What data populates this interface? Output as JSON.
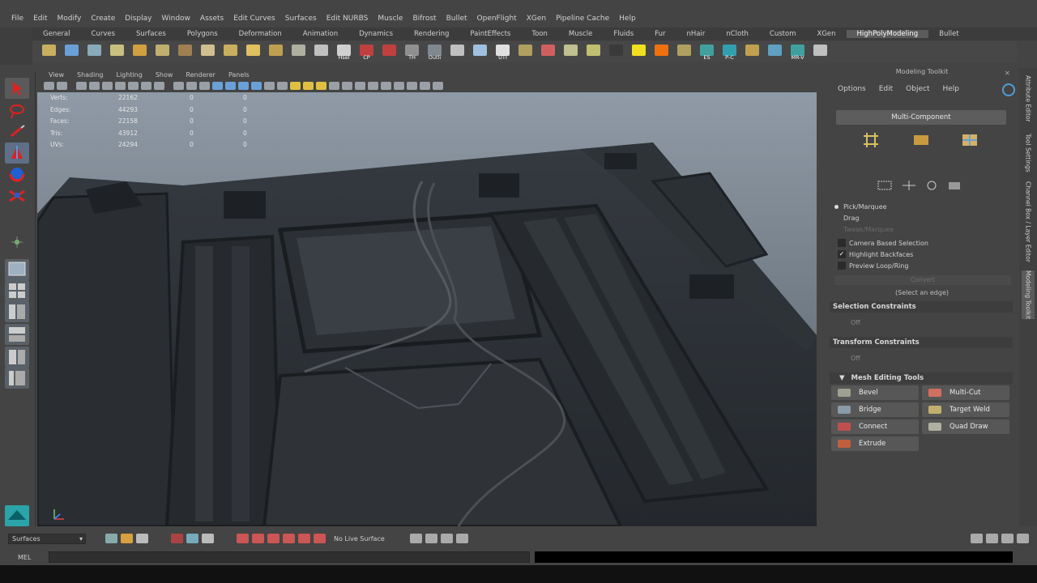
{
  "menubar": [
    "File",
    "Edit",
    "Modify",
    "Create",
    "Display",
    "Window",
    "Assets",
    "Edit Curves",
    "Surfaces",
    "Edit NURBS",
    "Muscle",
    "Bifrost",
    "Bullet",
    "OpenFlight",
    "XGen",
    "Pipeline Cache",
    "Help"
  ],
  "shelf_tabs": [
    "General",
    "Curves",
    "Surfaces",
    "Polygons",
    "Deformation",
    "Animation",
    "Dynamics",
    "Rendering",
    "PaintEffects",
    "Toon",
    "Muscle",
    "Fluids",
    "Fur",
    "nHair",
    "nCloth",
    "Custom",
    "XGen",
    "HighPolyModeling",
    "Bullet"
  ],
  "shelf_tab_active": "HighPolyModeling",
  "shelf_icon_labels": [
    "",
    "",
    "",
    "",
    "",
    "",
    "",
    "",
    "",
    "",
    "",
    "",
    "",
    "Hsel",
    "CP",
    "",
    "TH",
    "Outli",
    "",
    "",
    "UTI",
    "",
    "",
    "",
    "",
    "",
    "",
    "",
    "",
    "ES",
    "P-C",
    "",
    "",
    "MR-V",
    ""
  ],
  "viewport": {
    "menu": [
      "View",
      "Shading",
      "Lighting",
      "Show",
      "Renderer",
      "Panels"
    ],
    "hud": [
      [
        "Verts:",
        "22162",
        "0",
        "0"
      ],
      [
        "Edges:",
        "44293",
        "0",
        "0"
      ],
      [
        "Faces:",
        "22158",
        "0",
        "0"
      ],
      [
        "Tris:",
        "43912",
        "0",
        "0"
      ],
      [
        "UVs:",
        "24294",
        "0",
        "0"
      ]
    ]
  },
  "panel": {
    "title": "Modeling Toolkit",
    "menu": [
      "Options",
      "Edit",
      "Object",
      "Help"
    ],
    "multi_component": "Multi-Component",
    "selection_modes": [
      "Pick/Marquee",
      "Drag",
      "Tweak/Marquee"
    ],
    "checkboxes": [
      {
        "label": "Camera Based Selection",
        "checked": false
      },
      {
        "label": "Highlight Backfaces",
        "checked": true
      },
      {
        "label": "Preview Loop/Ring",
        "checked": false
      }
    ],
    "convert_button": "Convert",
    "hint": "(Select an edge)",
    "sections": {
      "selection_constraints": "Selection Constraints",
      "sc_off": "Off",
      "transform_constraints": "Transform Constraints",
      "tc_off": "Off",
      "mesh_editing_tools": "Mesh Editing Tools"
    },
    "tools": [
      "Bevel",
      "Multi-Cut",
      "Bridge",
      "Target Weld",
      "Connect",
      "Quad Draw",
      "Extrude"
    ]
  },
  "vertical_tabs": [
    "Attribute Editor",
    "Tool Settings",
    "Channel Box / Layer Editor",
    "Modeling Toolkit"
  ],
  "statusbar": {
    "menu_set": "Surfaces",
    "live_surface": "No Live Surface"
  },
  "cmdline": {
    "label": "MEL"
  },
  "colors": {
    "bg": "#444444",
    "accent": "#4f9fd6",
    "panel": "#3d3d3d",
    "viewport_top": "#8f9aa6"
  }
}
